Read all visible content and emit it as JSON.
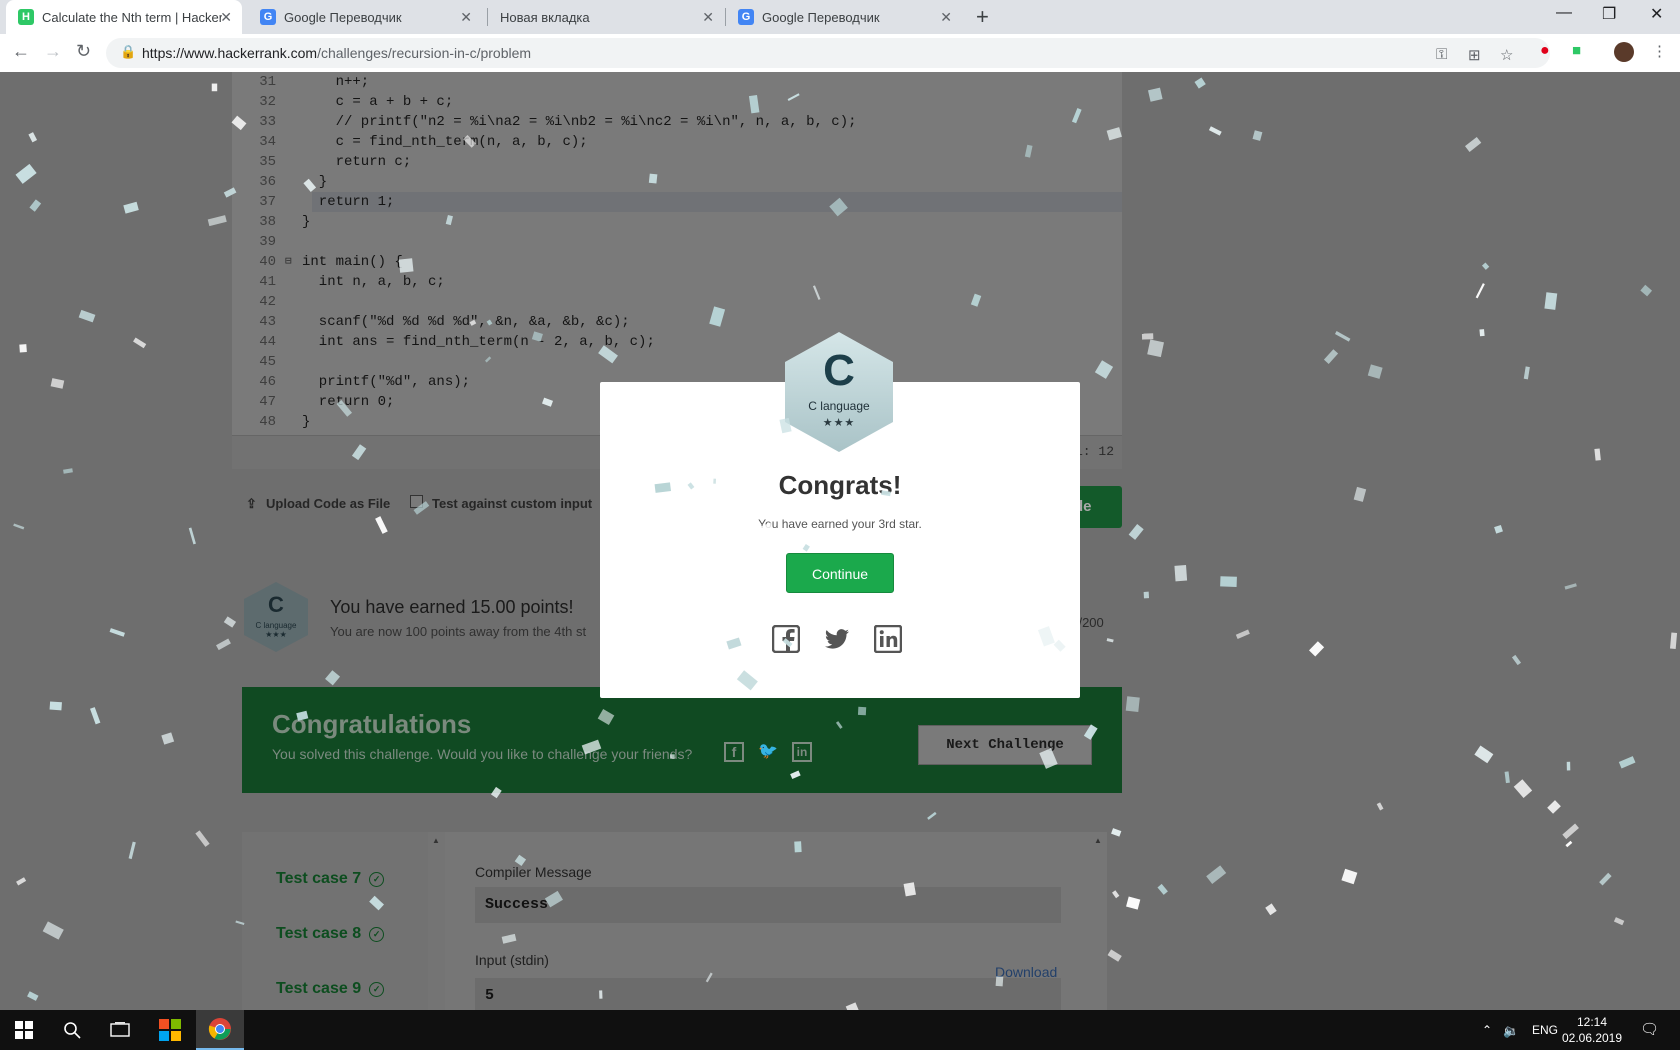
{
  "browser": {
    "tabs": [
      {
        "title": "Calculate the Nth term | HackerR",
        "favicon": "hackerrank-icon",
        "active": true
      },
      {
        "title": "Google Переводчик",
        "favicon": "google-translate-icon",
        "active": false
      },
      {
        "title": "Новая вкладка",
        "favicon": "none",
        "active": false
      },
      {
        "title": "Google Переводчик",
        "favicon": "google-translate-icon",
        "active": false
      }
    ],
    "url_host": "https://www.hackerrank.com",
    "url_path": "/challenges/recursion-in-c/problem",
    "window_controls": [
      "minimize",
      "maximize",
      "close"
    ]
  },
  "editor": {
    "lines": [
      {
        "n": "31",
        "code": "    n++;"
      },
      {
        "n": "32",
        "code": "    c = a + b + c;"
      },
      {
        "n": "33",
        "code": "    // printf(\"n2 = %i\\na2 = %i\\nb2 = %i\\nc2 = %i\\n\", n, a, b, c);"
      },
      {
        "n": "34",
        "code": "    c = find_nth_term(n, a, b, c);"
      },
      {
        "n": "35",
        "code": "    return c;"
      },
      {
        "n": "36",
        "code": "  }"
      },
      {
        "n": "37",
        "code": "  return 1;"
      },
      {
        "n": "38",
        "code": "}"
      },
      {
        "n": "39",
        "code": ""
      },
      {
        "n": "40",
        "code": "int main() {"
      },
      {
        "n": "41",
        "code": "  int n, a, b, c;"
      },
      {
        "n": "42",
        "code": ""
      },
      {
        "n": "43",
        "code": "  scanf(\"%d %d %d %d\", &n, &a, &b, &c);"
      },
      {
        "n": "44",
        "code": "  int ans = find_nth_term(n - 2, a, b, c);"
      },
      {
        "n": "45",
        "code": ""
      },
      {
        "n": "46",
        "code": "  printf(\"%d\", ans);"
      },
      {
        "n": "47",
        "code": "  return 0;"
      },
      {
        "n": "48",
        "code": "}"
      }
    ],
    "cursor_pos": "1: 12"
  },
  "below_editor": {
    "upload_label": "Upload Code as File",
    "custom_input_label": "Test against custom input",
    "submit_label_visible": "de"
  },
  "points": {
    "badge_letter": "C",
    "badge_language": "C language",
    "badge_stars": "★★★",
    "title": "You have earned 15.00 points!",
    "subtitle": "You are now 100 points away from the 4th st",
    "progress": "00/200"
  },
  "congrats_bar": {
    "heading": "Congratulations",
    "text": "You solved this challenge. Would you like to challenge your friends?",
    "next_label": "Next Challenge"
  },
  "test_cases": {
    "items": [
      "Test case 7",
      "Test case 8",
      "Test case 9"
    ],
    "compiler_label": "Compiler Message",
    "compiler_value": "Success",
    "input_label": "Input (stdin)",
    "input_value": "5",
    "download_label": "Download"
  },
  "modal": {
    "badge_letter": "C",
    "badge_language": "C language",
    "badge_stars": "★★★",
    "title": "Congrats!",
    "subtitle": "You have earned your 3rd star.",
    "continue_label": "Continue",
    "social": [
      "facebook-icon",
      "twitter-icon",
      "linkedin-icon"
    ]
  },
  "taskbar": {
    "language": "ENG",
    "time": "12:14",
    "date": "02.06.2019"
  },
  "colors": {
    "accent_green": "#1ba94c",
    "hackerrank_green": "#2ec866",
    "overlay": "#6e6e6e"
  }
}
